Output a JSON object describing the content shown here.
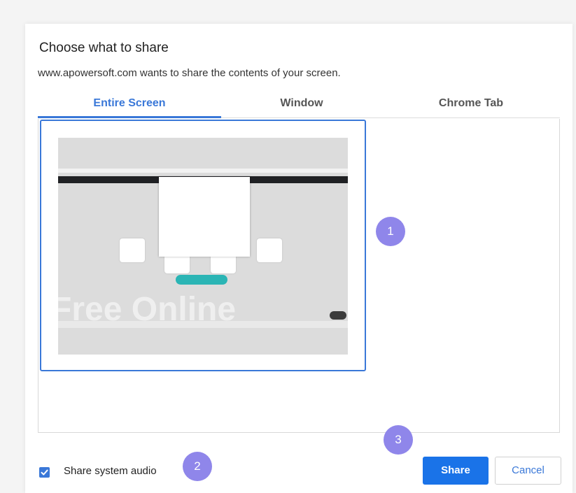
{
  "dialog": {
    "title": "Choose what to share",
    "subtitle": "www.apowersoft.com wants to share the contents of your screen."
  },
  "tabs": [
    {
      "label": "Entire Screen",
      "active": true
    },
    {
      "label": "Window",
      "active": false
    },
    {
      "label": "Chrome Tab",
      "active": false
    }
  ],
  "preview": {
    "watermark": "Free Online"
  },
  "annotations": {
    "badge_1": "1",
    "badge_2": "2",
    "badge_3": "3",
    "badge_color": "#8f86ea"
  },
  "footer": {
    "audio_checkbox_checked": true,
    "audio_label": "Share system audio",
    "share_label": "Share",
    "cancel_label": "Cancel"
  },
  "colors": {
    "accent": "#1a73e8",
    "selection": "#3a78d8"
  }
}
